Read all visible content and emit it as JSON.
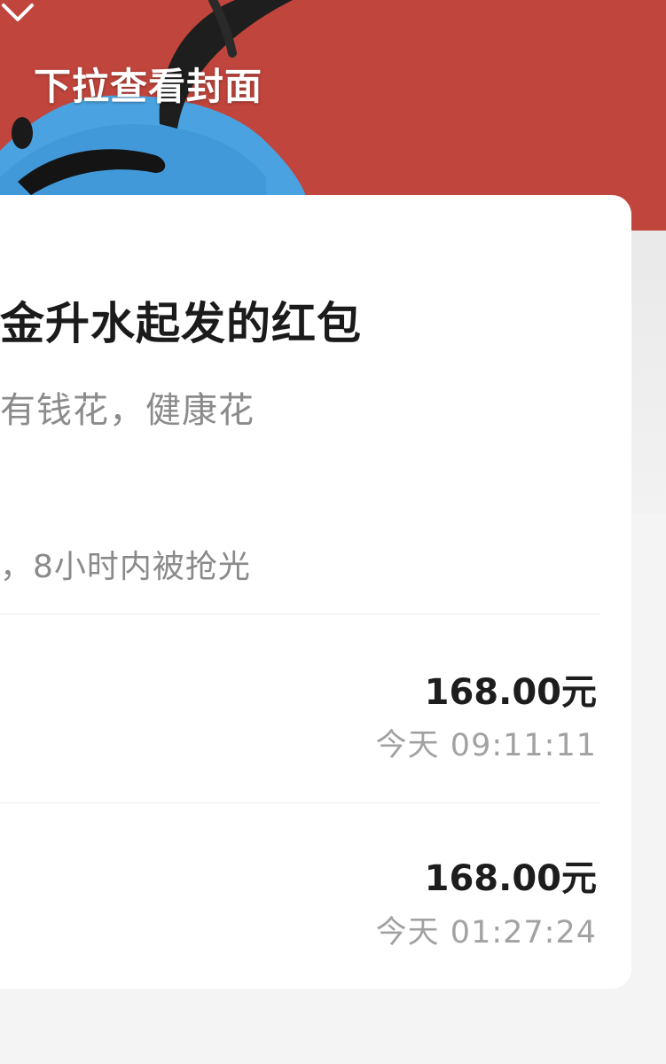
{
  "cover": {
    "pull_hint": "下拉查看封面",
    "background_color": "#c0453c",
    "chevron_icon": "chevron-down-icon"
  },
  "packet": {
    "title": "金升水起发的红包",
    "wish": "有钱花，健康花",
    "summary": "，8小时内被抢光"
  },
  "records": [
    {
      "amount": "168.00元",
      "time": "今天 09:11:11"
    },
    {
      "amount": "168.00元",
      "time": "今天 01:27:24"
    }
  ]
}
